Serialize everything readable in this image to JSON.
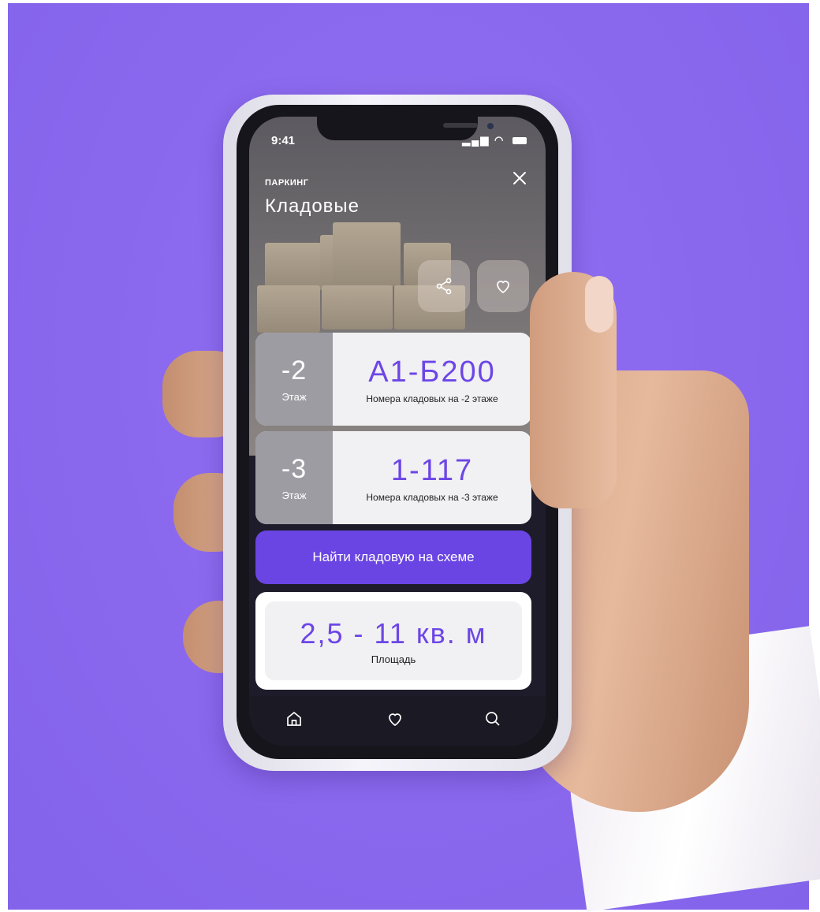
{
  "status_bar": {
    "time": "9:41",
    "signal": "ıll",
    "wifi": "≈"
  },
  "header": {
    "caption": "ПАРКИНГ",
    "title": "Кладовые"
  },
  "actions": {
    "share_icon": "share-icon",
    "favorite_icon": "heart-icon",
    "close_icon": "close-icon"
  },
  "floors": [
    {
      "number": "-2",
      "label": "Этаж",
      "range": "А1-Б200",
      "description": "Номера кладовых на -2 этаже"
    },
    {
      "number": "-3",
      "label": "Этаж",
      "range": "1-117",
      "description": "Номера кладовых на -3 этаже"
    }
  ],
  "find_button": {
    "label": "Найти кладовую на схеме"
  },
  "area": {
    "value": "2,5 - 11 кв. м",
    "label": "Площадь"
  },
  "tab_bar": {
    "items": [
      "home-icon",
      "heart-icon",
      "search-icon"
    ]
  },
  "colors": {
    "background": "#8a68ee",
    "accent": "#6a45e3",
    "accent_text": "#6c46e6",
    "card": "#f1f0f3",
    "floor_badge": "#9e9ca3"
  }
}
